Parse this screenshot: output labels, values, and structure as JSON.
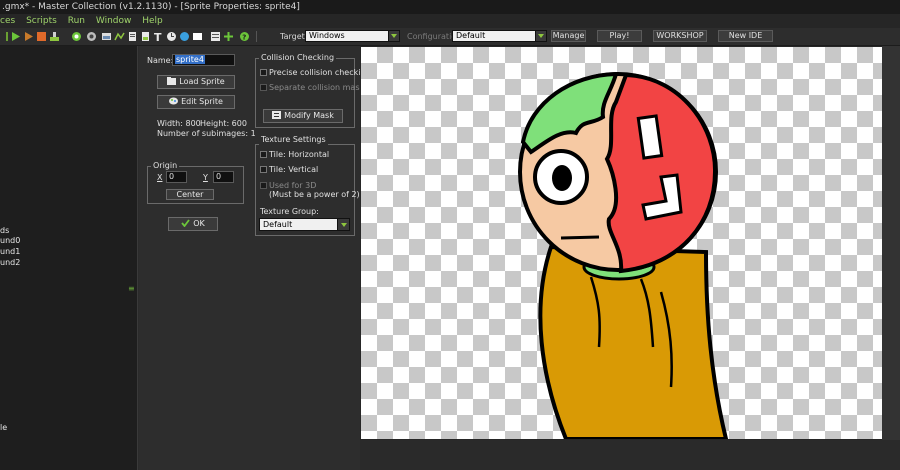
{
  "window": {
    "title": ".gmx* - Master Collection (v1.2.1130) - [Sprite Properties: sprite4]"
  },
  "menu": [
    "ces",
    "Scripts",
    "Run",
    "Window",
    "Help"
  ],
  "toolbar": {
    "target_label": "Target:",
    "target_value": "Windows",
    "config_label": "Configuration:",
    "config_value": "Default",
    "manage": "Manage",
    "play": "Play!",
    "workshop": "WORKSHOP",
    "new_ide": "New IDE"
  },
  "tree": {
    "items": [
      "ds",
      "und0",
      "und1",
      "und2",
      "le"
    ]
  },
  "sprite": {
    "name_label": "Name:",
    "name_value": "sprite4",
    "load_sprite": "Load Sprite",
    "edit_sprite": "Edit Sprite",
    "width_text": "Width: 800",
    "height_text": "Height: 600",
    "subimages_text": "Number of subimages: 1",
    "origin": {
      "title": "Origin",
      "x_label": "X",
      "x_value": "0",
      "y_label": "Y",
      "y_value": "0",
      "center": "Center"
    },
    "ok": "OK"
  },
  "collision": {
    "title": "Collision Checking",
    "precise": "Precise collision checking",
    "separate": "Separate collision masks",
    "modify_mask": "Modify Mask"
  },
  "texture": {
    "title": "Texture Settings",
    "tile_h": "Tile: Horizontal",
    "tile_v": "Tile: Vertical",
    "used_3d": "Used for 3D",
    "used_3d_note": "(Must be a power of 2)",
    "group_label": "Texture Group:",
    "group_value": "Default"
  },
  "colors": {
    "accent_green": "#8ec63f",
    "menu_text": "#9fd36b",
    "mask_red": "#f24444",
    "hair_green": "#7fe07a",
    "skin": "#f6c9a3",
    "sweater": "#d99a05"
  }
}
